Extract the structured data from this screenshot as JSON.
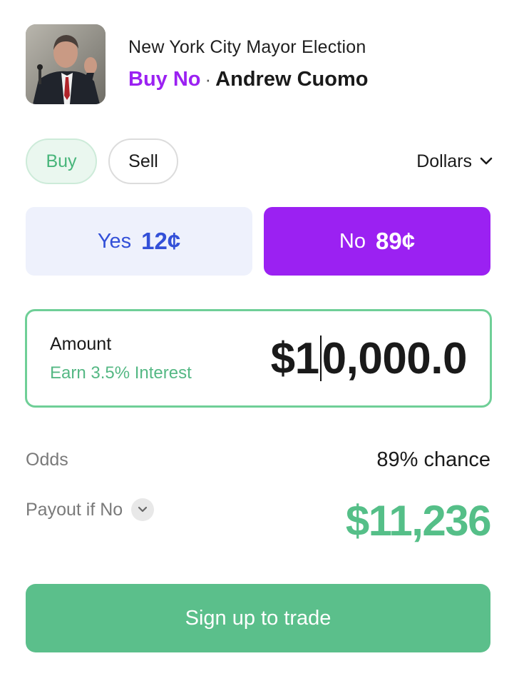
{
  "header": {
    "market_title": "New York City Mayor Election",
    "action": "Buy No",
    "separator": "·",
    "candidate": "Andrew Cuomo"
  },
  "mode": {
    "buy_label": "Buy",
    "sell_label": "Sell",
    "selected": "Buy",
    "currency_label": "Dollars"
  },
  "sides": {
    "yes": {
      "label": "Yes",
      "price": "12¢"
    },
    "no": {
      "label": "No",
      "price": "89¢"
    },
    "selected": "No"
  },
  "amount": {
    "label": "Amount",
    "interest_text": "Earn 3.5% Interest",
    "value_before_caret": "$1",
    "value_after_caret": "0,000.0"
  },
  "summary": {
    "odds_label": "Odds",
    "odds_value": "89% chance",
    "payout_label": "Payout if No",
    "payout_value": "$11,236"
  },
  "cta": {
    "label": "Sign up to trade"
  },
  "colors": {
    "purple": "#9b21f2",
    "green": "#5bbf8b",
    "yes_blue": "#3350d8",
    "yes_bg": "#eef1fc",
    "amount_border": "#6fcf97"
  },
  "icons": [
    "chevron-down-icon",
    "chevron-down-icon"
  ]
}
